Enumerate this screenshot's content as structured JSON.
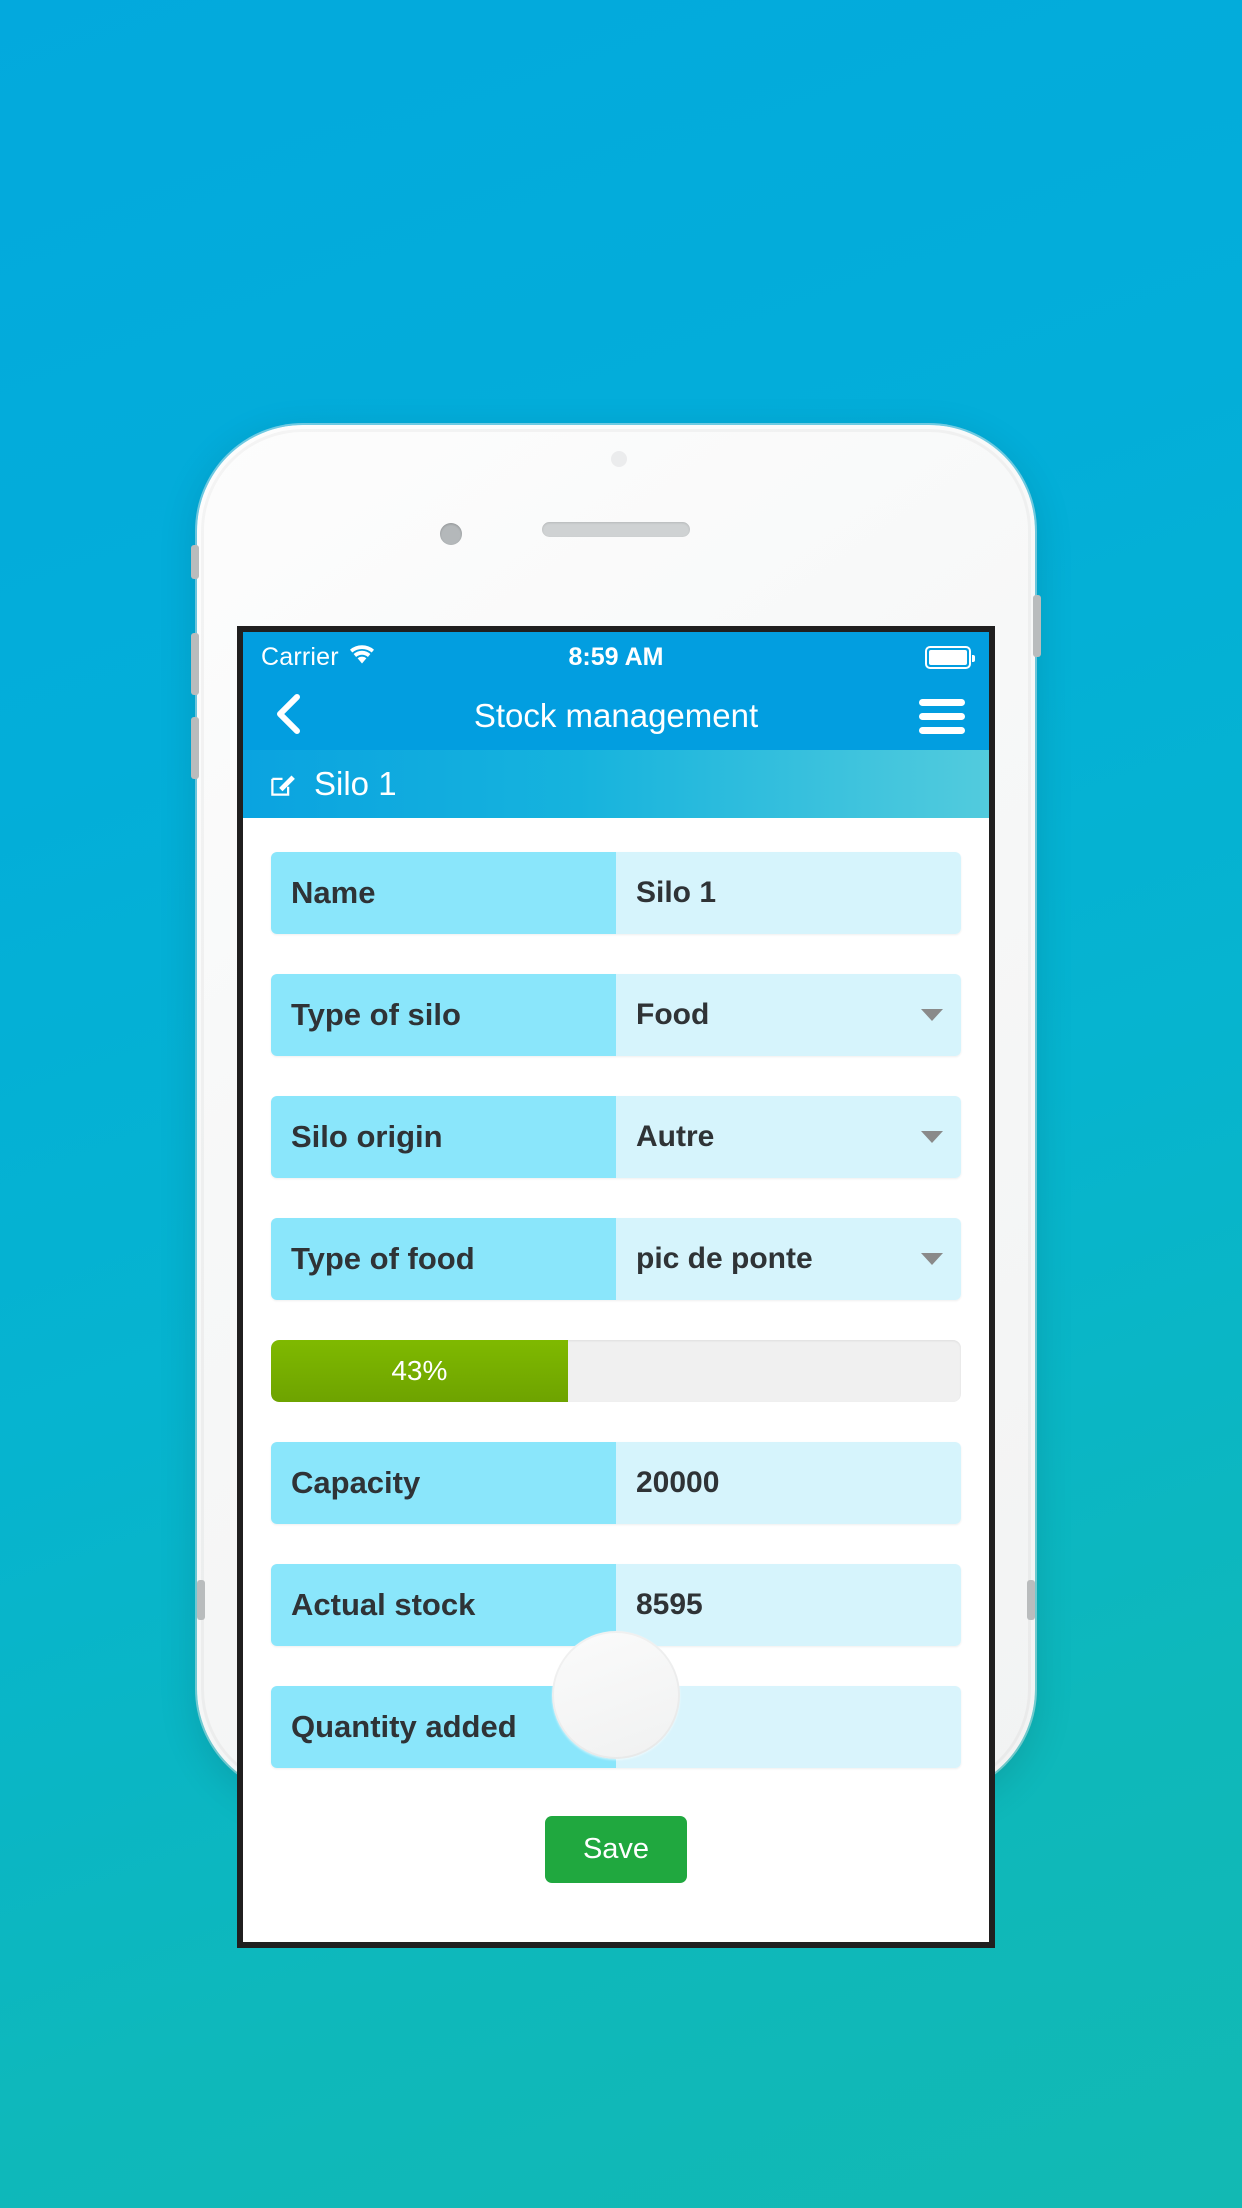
{
  "background": {
    "gradient_from": "#03a9dd",
    "gradient_to": "#12b9b3"
  },
  "device": {
    "frame_color": "#f7f8f8",
    "bezel_color": "#201f1f"
  },
  "statusbar": {
    "carrier": "Carrier",
    "wifi_icon": "wifi-icon",
    "time": "8:59 AM",
    "battery_icon": "battery-full-icon"
  },
  "navbar": {
    "back_icon": "chevron-left-icon",
    "title": "Stock management",
    "menu_icon": "hamburger-menu-icon",
    "background": "#029ee0"
  },
  "silobar": {
    "edit_icon": "edit-pencil-icon",
    "title": "Silo 1",
    "gradient_from": "#0aa3e0",
    "gradient_to": "#52cbdd"
  },
  "form": {
    "rows": [
      {
        "label": "Name",
        "value": "Silo 1",
        "type": "text",
        "caret": false
      },
      {
        "label": "Type of silo",
        "value": "Food",
        "type": "select",
        "caret": true
      },
      {
        "label": "Silo origin",
        "value": "Autre",
        "type": "select",
        "caret": true
      },
      {
        "label": "Type of food",
        "value": "pic de  ponte",
        "type": "select",
        "caret": true
      }
    ],
    "rows_lower": [
      {
        "label": "Capacity",
        "value": "20000",
        "type": "text",
        "caret": false
      },
      {
        "label": "Actual stock",
        "value": "8595",
        "type": "text",
        "caret": false
      },
      {
        "label": "Quantity added",
        "value": "",
        "type": "text",
        "caret": false
      }
    ],
    "label_color": "#8ae6fb",
    "value_color": "#d6f4fc"
  },
  "progress": {
    "label": "43%",
    "percent": 43,
    "fill_color": "#77b100",
    "track_color": "#f0f0f0"
  },
  "actions": {
    "save_label": "Save",
    "save_color": "#20a83f"
  }
}
